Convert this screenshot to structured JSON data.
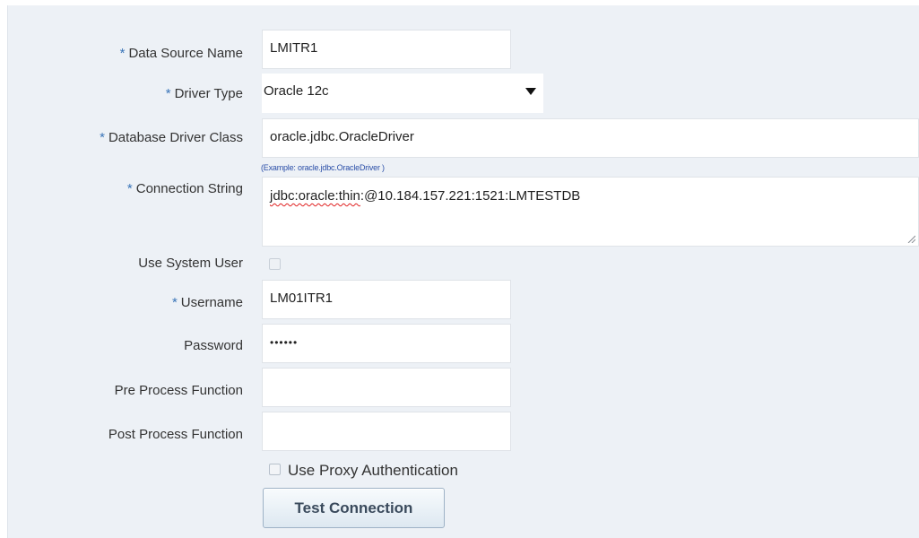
{
  "form": {
    "required_marker": "*",
    "data_source_name": {
      "label": "Data Source Name",
      "value": "LMITR1",
      "required": true
    },
    "driver_type": {
      "label": "Driver Type",
      "value": "Oracle 12c",
      "required": true
    },
    "database_driver_class": {
      "label": "Database Driver Class",
      "value": "oracle.jdbc.OracleDriver",
      "hint": "(Example: oracle.jdbc.OracleDriver )",
      "required": true
    },
    "connection_string": {
      "label": "Connection String",
      "value_underlined": "jdbc:oracle:thin",
      "value_rest": ":@10.184.157.221:1521:LMTESTDB",
      "required": true
    },
    "use_system_user": {
      "label": "Use System User",
      "checked": false,
      "disabled": true
    },
    "username": {
      "label": "Username",
      "value": "LM01ITR1",
      "required": true
    },
    "password": {
      "label": "Password",
      "value": "••••••"
    },
    "pre_process_function": {
      "label": "Pre Process Function",
      "value": ""
    },
    "post_process_function": {
      "label": "Post Process Function",
      "value": ""
    },
    "use_proxy_authentication": {
      "label": "Use Proxy Authentication",
      "checked": false
    },
    "test_connection_button": {
      "label": "Test Connection"
    }
  },
  "colors": {
    "panel_background": "#edf1f6",
    "required_marker": "#3a75b8",
    "hint_text": "#2b4fa8",
    "button_text": "#3a4a5c"
  }
}
